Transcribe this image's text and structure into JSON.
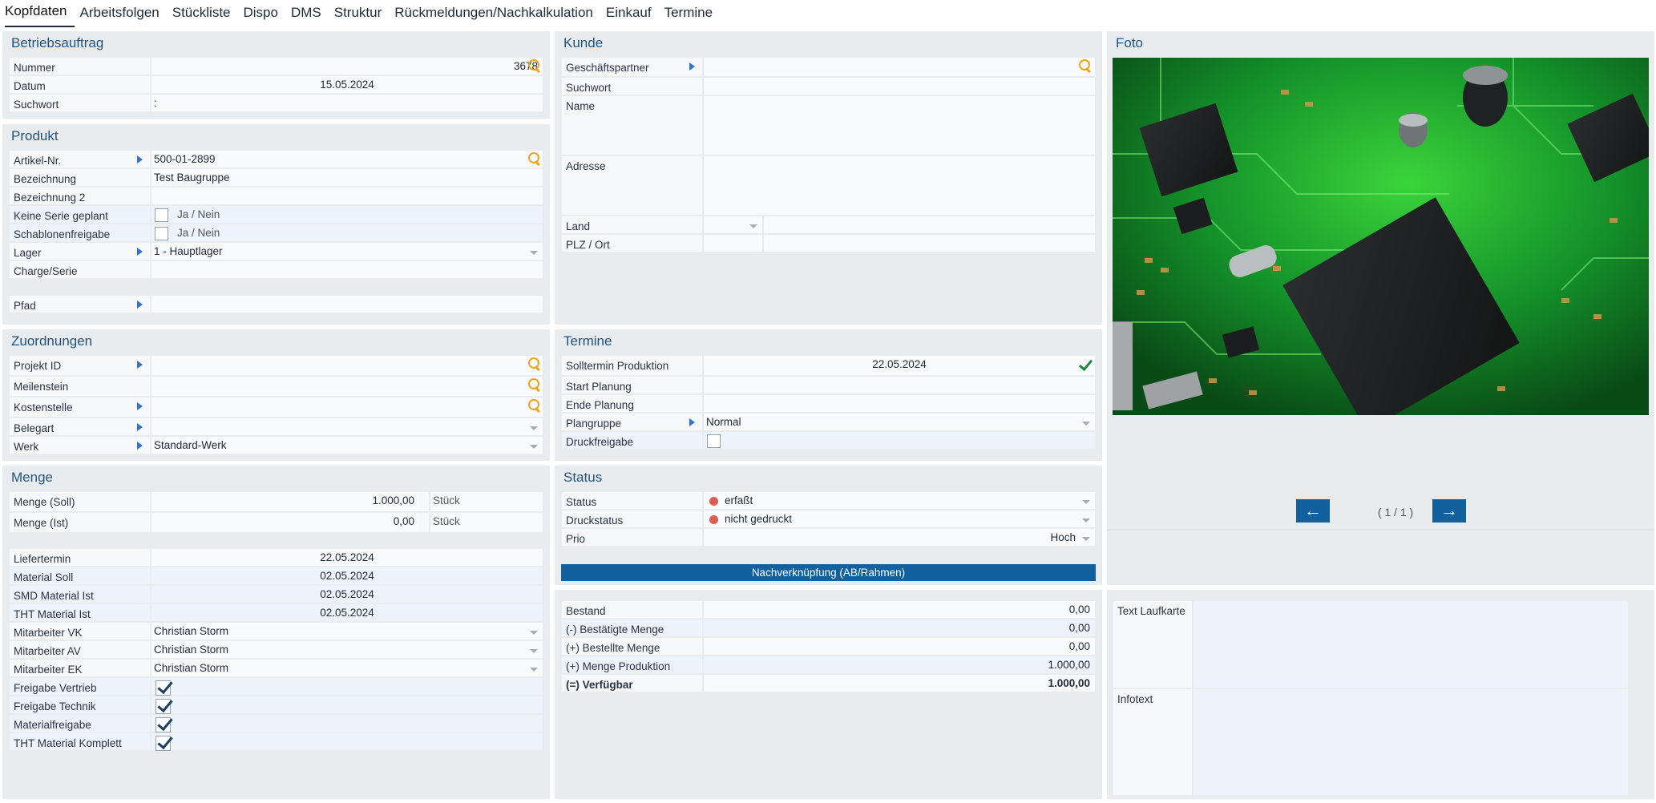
{
  "tabs": [
    "Kopfdaten",
    "Arbeitsfolgen",
    "Stückliste",
    "Dispo",
    "DMS",
    "Struktur",
    "Rückmeldungen/Nachkalkulation",
    "Einkauf",
    "Termine"
  ],
  "betriebsauftrag": {
    "title": "Betriebsauftrag",
    "nummer_label": "Nummer",
    "nummer": "3678",
    "datum_label": "Datum",
    "datum": "15.05.2024",
    "suchwort_label": "Suchwort",
    "suchwort": ":"
  },
  "produkt": {
    "title": "Produkt",
    "artikel_label": "Artikel-Nr.",
    "artikel": "500-01-2899",
    "bez_label": "Bezeichnung",
    "bez": "Test Baugruppe",
    "bez2_label": "Bezeichnung 2",
    "keine_serie_label": "Keine Serie geplant",
    "jn": "Ja / Nein",
    "schablonen_label": "Schablonenfreigabe",
    "lager_label": "Lager",
    "lager": "1 - Hauptlager",
    "charge_label": "Charge/Serie",
    "pfad_label": "Pfad"
  },
  "zuordnungen": {
    "title": "Zuordnungen",
    "projekt_label": "Projekt ID",
    "meilenstein_label": "Meilenstein",
    "kostenstelle_label": "Kostenstelle",
    "belegart_label": "Belegart",
    "werk_label": "Werk",
    "werk": "Standard-Werk"
  },
  "menge": {
    "title": "Menge",
    "soll_label": "Menge (Soll)",
    "soll": "1.000,00",
    "ist_label": "Menge (Ist)",
    "ist": "0,00",
    "unit": "Stück",
    "liefertermin_label": "Liefertermin",
    "liefertermin": "22.05.2024",
    "matsoll_label": "Material Soll",
    "matsoll": "02.05.2024",
    "smd_label": "SMD Material Ist",
    "smd": "02.05.2024",
    "tht_label": "THT Material Ist",
    "tht": "02.05.2024",
    "vk_label": "Mitarbeiter VK",
    "vk": "Christian Storm",
    "av_label": "Mitarbeiter AV",
    "av": "Christian Storm",
    "ek_label": "Mitarbeiter EK",
    "ek": "Christian Storm",
    "fv_label": "Freigabe Vertrieb",
    "ft_label": "Freigabe Technik",
    "mf_label": "Materialfreigabe",
    "thtk_label": "THT Material Komplett"
  },
  "kunde": {
    "title": "Kunde",
    "gp_label": "Geschäftspartner",
    "suchwort_label": "Suchwort",
    "name_label": "Name",
    "adresse_label": "Adresse",
    "land_label": "Land",
    "plz_label": "PLZ / Ort"
  },
  "termine": {
    "title": "Termine",
    "soll_label": "Solltermin Produktion",
    "soll": "22.05.2024",
    "start_label": "Start Planung",
    "ende_label": "Ende Planung",
    "plangruppe_label": "Plangruppe",
    "plangruppe": "Normal",
    "druckfreigabe_label": "Druckfreigabe"
  },
  "status": {
    "title": "Status",
    "status_label": "Status",
    "status": "erfaßt",
    "druck_label": "Druckstatus",
    "druck": "nicht gedruckt",
    "prio_label": "Prio",
    "prio": "Hoch",
    "button": "Nachverknüpfung (AB/Rahmen)"
  },
  "bestand": {
    "bestand_label": "Bestand",
    "bestand": "0,00",
    "bestaetigt_label": "(-) Bestätigte Menge",
    "bestaetigt": "0,00",
    "bestellt_label": "(+) Bestellte Menge",
    "bestellt": "0,00",
    "produktion_label": "(+) Menge Produktion",
    "produktion": "1.000,00",
    "verfuegbar_label": "(=) Verfügbar",
    "verfuegbar": "1.000,00"
  },
  "foto": {
    "title": "Foto",
    "pager": "( 1 / 1 )"
  },
  "texte": {
    "laufkarte_label": "Text Laufkarte",
    "info_label": "Infotext"
  },
  "colors": {
    "accent": "#12609e",
    "title": "#24537d",
    "panel": "#e9ecef",
    "status_red": "#e05b53",
    "search": "#f2a31b"
  }
}
